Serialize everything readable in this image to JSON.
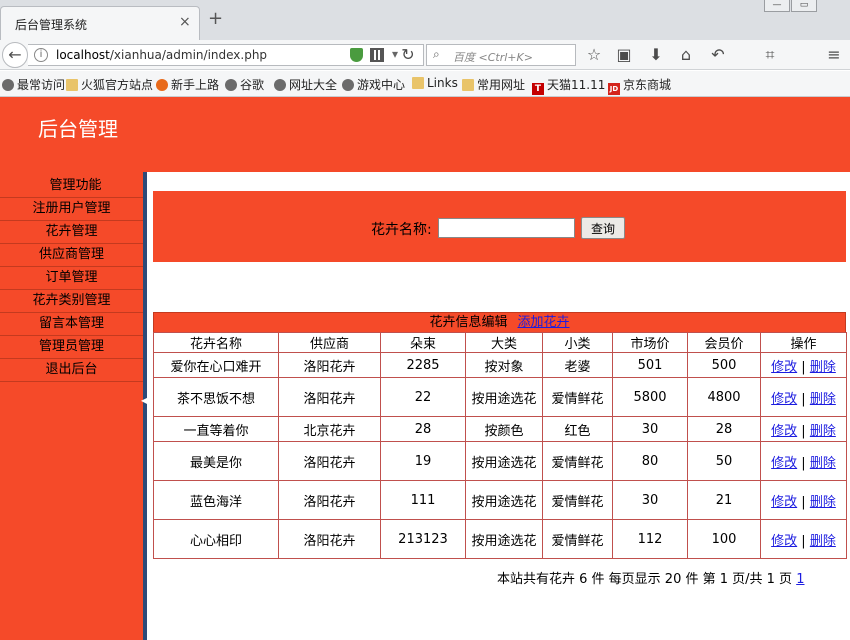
{
  "browser": {
    "tab_title": "后台管理系统",
    "tab_close": "×",
    "new_tab": "+",
    "url_prefix": "localhost",
    "url_path": "/xianhua/admin/index.php",
    "search_placeholder": "百度 <Ctrl+K>",
    "bookmarks": [
      "最常访问",
      "火狐官方站点",
      "新手上路",
      "谷歌",
      "网址大全",
      "游戏中心",
      "Links",
      "常用网址",
      "天猫11.11",
      "京东商城"
    ]
  },
  "header": {
    "title": "后台管理"
  },
  "sidebar": {
    "items": [
      "管理功能",
      "注册用户管理",
      "花卉管理",
      "供应商管理",
      "订单管理",
      "花卉类别管理",
      "留言本管理",
      "管理员管理",
      "退出后台"
    ]
  },
  "search": {
    "label": "花卉名称:",
    "value": "",
    "button": "查询"
  },
  "table": {
    "caption": "花卉信息编辑",
    "add_link": "添加花卉",
    "headers": [
      "花卉名称",
      "供应商",
      "朵束",
      "大类",
      "小类",
      "市场价",
      "会员价",
      "操作"
    ],
    "edit_label": "修改",
    "sep": "|",
    "delete_label": "删除",
    "rows": [
      {
        "name": "爱你在心口难开",
        "supplier": "洛阳花卉",
        "count": "2285",
        "category": "按对象",
        "subcategory": "老婆",
        "market_price": "501",
        "member_price": "500"
      },
      {
        "name": "茶不思饭不想",
        "supplier": "洛阳花卉",
        "count": "22",
        "category": "按用途选花",
        "subcategory": "爱情鲜花",
        "market_price": "5800",
        "member_price": "4800"
      },
      {
        "name": "一直等着你",
        "supplier": "北京花卉",
        "count": "28",
        "category": "按颜色",
        "subcategory": "红色",
        "market_price": "30",
        "member_price": "28"
      },
      {
        "name": "最美是你",
        "supplier": "洛阳花卉",
        "count": "19",
        "category": "按用途选花",
        "subcategory": "爱情鲜花",
        "market_price": "80",
        "member_price": "50"
      },
      {
        "name": "蓝色海洋",
        "supplier": "洛阳花卉",
        "count": "111",
        "category": "按用途选花",
        "subcategory": "爱情鲜花",
        "market_price": "30",
        "member_price": "21"
      },
      {
        "name": "心心相印",
        "supplier": "洛阳花卉",
        "count": "213123",
        "category": "按用途选花",
        "subcategory": "爱情鲜花",
        "market_price": "112",
        "member_price": "100"
      }
    ]
  },
  "pager": {
    "text": "本站共有花卉 6  件 每页显示 20 件 第 1 页/共 1 页",
    "page_link": "1"
  },
  "colors": {
    "accent": "#f54a29",
    "sidebar_border": "#2d4a78",
    "link": "#1c1ce0"
  }
}
